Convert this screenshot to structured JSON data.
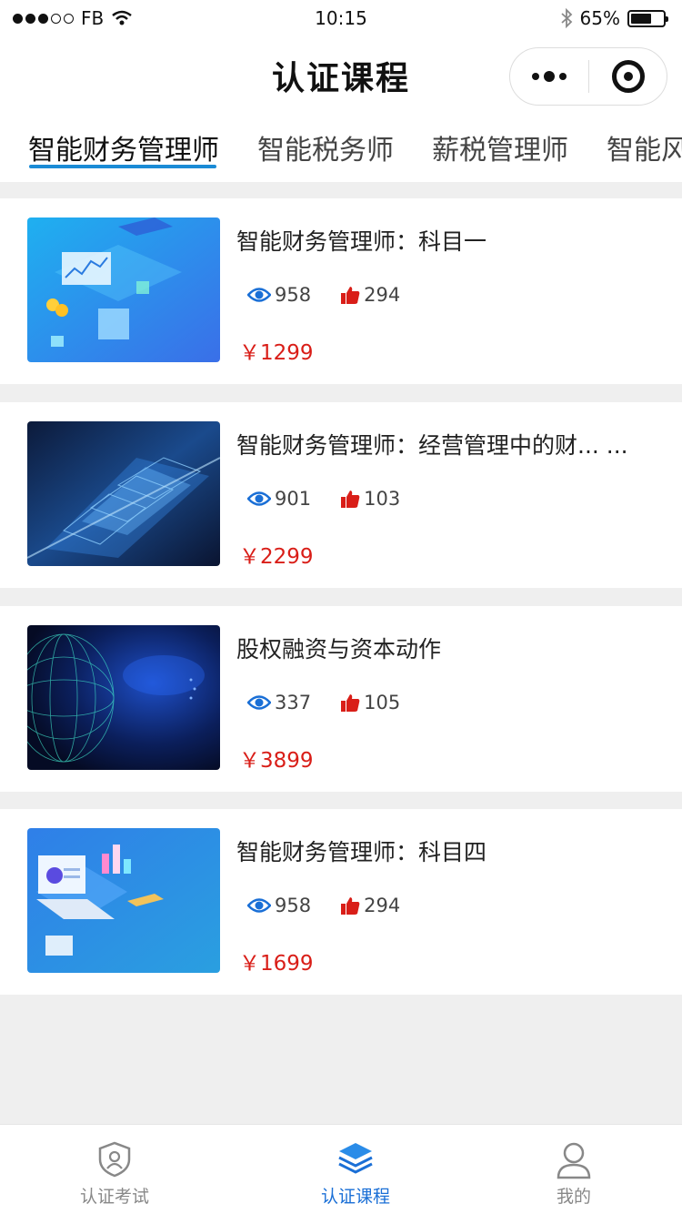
{
  "status_bar": {
    "carrier": "FB",
    "time": "10:15",
    "battery_percent_text": "65%",
    "battery_level": 0.65
  },
  "nav": {
    "title": "认证课程"
  },
  "tabs": [
    {
      "label": "智能财务管理师",
      "active": true
    },
    {
      "label": "智能税务师",
      "active": false
    },
    {
      "label": "薪税管理师",
      "active": false
    },
    {
      "label": "智能风",
      "active": false
    }
  ],
  "courses": [
    {
      "title": "智能财务管理师：科目一",
      "views": "958",
      "likes": "294",
      "price": "￥1299",
      "thumb": "isometric-finance-dashboard"
    },
    {
      "title": "智能财务管理师：经营管理中的财... ...",
      "views": "901",
      "likes": "103",
      "price": "￥2299",
      "thumb": "glowing-data-panels"
    },
    {
      "title": "股权融资与资本动作",
      "views": "337",
      "likes": "105",
      "price": "￥3899",
      "thumb": "digital-globe"
    },
    {
      "title": "智能财务管理师：科目四",
      "views": "958",
      "likes": "294",
      "price": "￥1699",
      "thumb": "isometric-laptop-charts"
    }
  ],
  "tabbar": [
    {
      "label": "认证考试",
      "icon": "shield-user-icon",
      "active": false
    },
    {
      "label": "认证课程",
      "icon": "layers-icon",
      "active": true
    },
    {
      "label": "我的",
      "icon": "person-icon",
      "active": false
    }
  ],
  "colors": {
    "accent_blue": "#1a8bd6",
    "price_red": "#d91e18",
    "icon_blue": "#1a6fd6",
    "background": "#efefef"
  }
}
